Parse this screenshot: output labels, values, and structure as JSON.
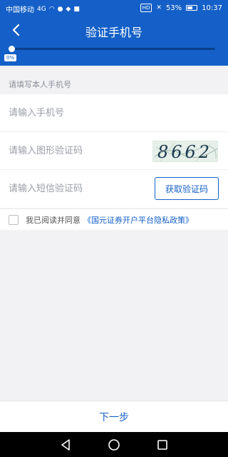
{
  "status_bar": {
    "carrier": "中国移动",
    "network": "4G",
    "battery": "53%",
    "time": "10:37"
  },
  "header": {
    "title": "验证手机号",
    "progress_label": "0%",
    "progress": 0
  },
  "form": {
    "section_label": "请填写本人手机号",
    "phone_placeholder": "请输入手机号",
    "captcha_placeholder": "请输入图形验证码",
    "captcha_code": "8662",
    "sms_placeholder": "请输入短信验证码",
    "sms_button": "获取验证码"
  },
  "agreement": {
    "text": "我已阅读并同意",
    "policy": "《国元证券开户平台隐私政策》"
  },
  "footer": {
    "next_label": "下一步"
  },
  "colors": {
    "brand": "#1560c8",
    "page_bg": "#f2f2f4"
  }
}
